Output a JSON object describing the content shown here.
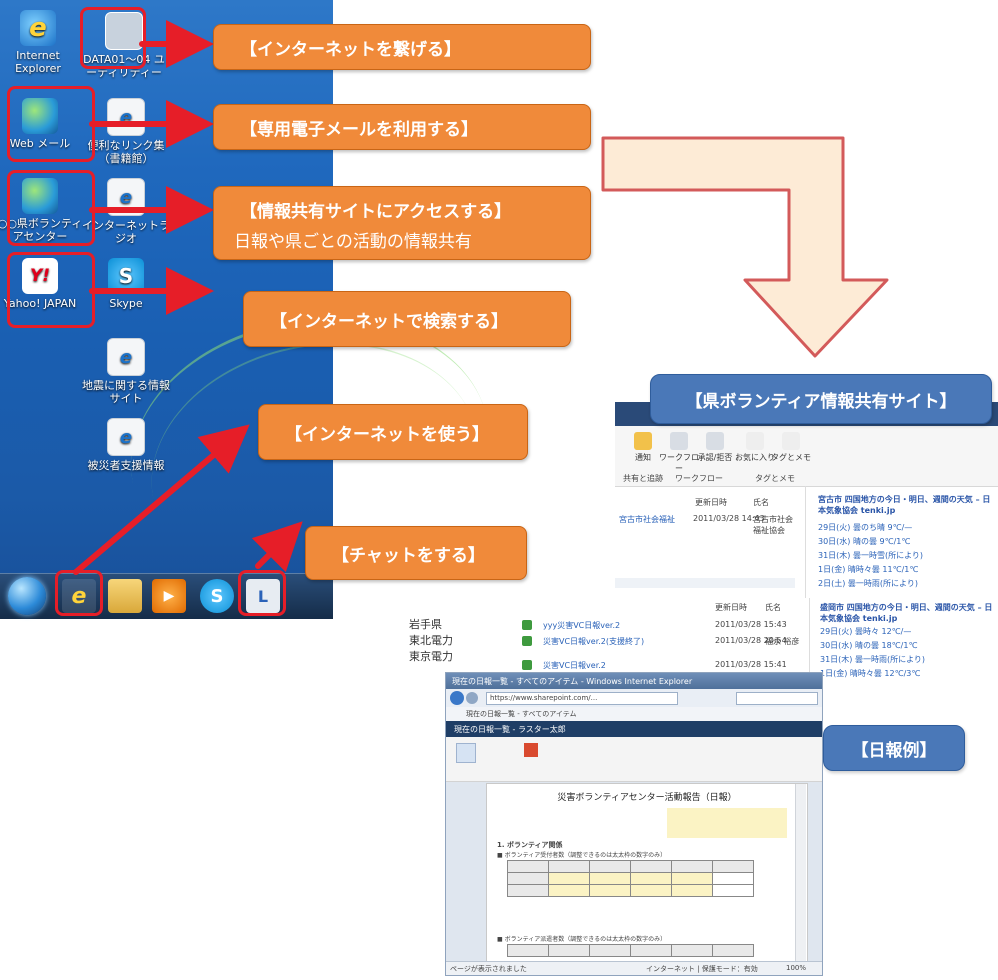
{
  "desktop": {
    "icons": {
      "ie": "Internet Explorer",
      "data": "DATA01～04 ユーティリティー",
      "webmail": "Web メール",
      "links": "便利なリンク集（書籍館）",
      "volunteer": "○○県ボランティアセンター",
      "radio": "インターネットラジオ",
      "yahoo": "Yahoo! JAPAN",
      "skype": "Skype",
      "site1": "地震に関する情報サイト",
      "site2": "被災者支援情報"
    }
  },
  "callouts": {
    "c1": "【インターネットを繋げる】",
    "c2": "【専用電子メールを利用する】",
    "c3": "【情報共有サイトにアクセスする】",
    "c3_sub": "日報や県ごとの活動の情報共有",
    "c4": "【インターネットで検索する】",
    "c5": "【インターネットを使う】",
    "c6": "【チャットをする】"
  },
  "labels": {
    "site_label": "【県ボランティア情報共有サイト】",
    "report_label": "【日報例】"
  },
  "sharepoint": {
    "ribbon": [
      "通知",
      "ワークフロー",
      "承認/拒否",
      "お気に入り",
      "タグとメモ"
    ],
    "ribbon_groups": [
      "共有と追跡",
      "ワークフロー",
      "タグとメモ"
    ],
    "list_headers": [
      "更新日時",
      "氏名"
    ],
    "list_row": [
      "宮古市社会福祉",
      "2011/03/28 14:43",
      "宮古市社会福祉協会"
    ],
    "weather_title": "宮古市 四国地方の今日・明日、週間の天気 – 日本気象協会 tenki.jp",
    "weather_rows": [
      "29日(火) 曇のち晴 9℃/—",
      "30日(水) 晴の曇 9℃/1℃",
      "31日(木) 曇一時雪(所により)",
      "1日(金) 晴時々曇 11℃/1℃",
      "2日(土) 曇一時雨(所により)"
    ],
    "weather_title2": "盛岡市 四国地方の今日・明日、週間の天気 – 日本気象協会 tenki.jp",
    "weather_rows2": [
      "29日(火) 曇時々 12℃/—",
      "30日(水) 晴の曇 18℃/1℃",
      "31日(木) 曇一時雨(所により)",
      "1日(金) 晴時々曇 12℃/3℃",
      "2日(土) 曇一時雨"
    ]
  },
  "sharepoint2": {
    "headers": [
      "更新日時",
      "氏名"
    ],
    "regions": [
      "岩手県",
      "東北電力",
      "東京電力"
    ],
    "rows": [
      {
        "name": "yyy災害VC日報ver.2",
        "date": "2011/03/28 15:43"
      },
      {
        "name": "災害VC日報ver.2(支援終了)",
        "date": "2011/03/28 20:54",
        "user": "福永 裕彦"
      },
      {
        "name": "災害VC日報ver.2",
        "date": "2011/03/28 15:41"
      }
    ]
  },
  "browser": {
    "title": "現在の日報一覧 - すべてのアイテム - Windows Internet Explorer",
    "url": "https://www.sharepoint.com/...",
    "fav": "現在の日報一覧 - すべてのアイテム",
    "header": "現在の日報一覧 - ラスター太郎",
    "report_title": "災害ボランティアセンター活動報告（日報）",
    "section1": "1. ボランティア関係",
    "section1_sub": "■ ボランティア受付者数（調整できるのは太太枠の数字のみ）",
    "section2_sub": "■ ボランティア派遣者数（調整できるのは太太枠の数字のみ）",
    "status_left": "ページが表示されました",
    "status_right": "インターネット | 保護モード：有効",
    "zoom": "100%"
  },
  "colors": {
    "callout": "#f08a3a",
    "red": "#e61e28",
    "blue_label": "#4a78b8",
    "arrow_fill": "#fdebd6",
    "arrow_stroke": "#d35a5a"
  }
}
